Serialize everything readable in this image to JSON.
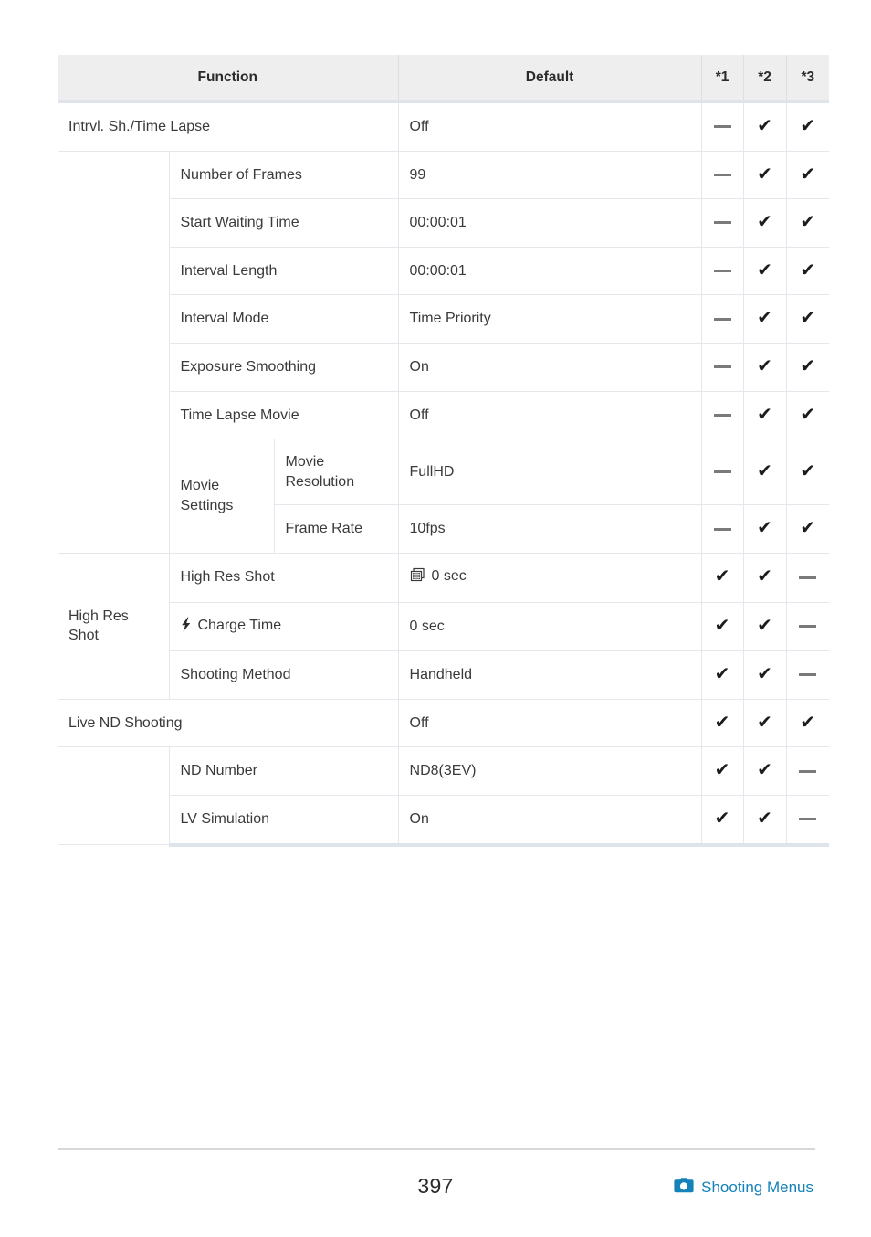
{
  "table": {
    "columns": [
      "Function",
      "Default",
      "*1",
      "*2",
      "*3"
    ],
    "headers": {
      "function": "Function",
      "default": "Default",
      "m1": "*1",
      "m2": "*2",
      "m3": "*3"
    },
    "groups": [
      {
        "group_label": "Intrvl. Sh./Time Lapse",
        "group_is_row": true,
        "row": {
          "name": "Intrvl. Sh./Time Lapse",
          "default": "Off",
          "m1": "dash",
          "m2": "check",
          "m3": "check"
        },
        "rows": [
          {
            "name": "Number of Frames",
            "default": "99",
            "m1": "dash",
            "m2": "check",
            "m3": "check"
          },
          {
            "name": "Start Waiting Time",
            "default": "00:00:01",
            "m1": "dash",
            "m2": "check",
            "m3": "check"
          },
          {
            "name": "Interval Length",
            "default": "00:00:01",
            "m1": "dash",
            "m2": "check",
            "m3": "check"
          },
          {
            "name": "Interval Mode",
            "default": "Time Priority",
            "m1": "dash",
            "m2": "check",
            "m3": "check"
          },
          {
            "name": "Exposure Smoothing",
            "default": "On",
            "m1": "dash",
            "m2": "check",
            "m3": "check"
          },
          {
            "name": "Time Lapse Movie",
            "default": "Off",
            "m1": "dash",
            "m2": "check",
            "m3": "check"
          }
        ],
        "subgroup": {
          "label": "Movie Settings",
          "rows": [
            {
              "name": "Movie Resolution",
              "default": "FullHD",
              "m1": "dash",
              "m2": "check",
              "m3": "check"
            },
            {
              "name": "Frame Rate",
              "default": "10fps",
              "m1": "dash",
              "m2": "check",
              "m3": "check"
            }
          ]
        }
      },
      {
        "group_label": "High Res Shot",
        "group_is_row": false,
        "rows": [
          {
            "name": "High Res Shot",
            "icon": null,
            "default": "0 sec",
            "default_icon": "sensor-shift-icon",
            "m1": "check",
            "m2": "check",
            "m3": "dash"
          },
          {
            "name": "Charge Time",
            "icon": "flash-icon",
            "default": "0 sec",
            "default_icon": null,
            "m1": "check",
            "m2": "check",
            "m3": "dash"
          },
          {
            "name": "Shooting Method",
            "icon": null,
            "default": "Handheld",
            "default_icon": null,
            "m1": "check",
            "m2": "check",
            "m3": "dash"
          }
        ]
      },
      {
        "group_label": "Live ND Shooting",
        "group_is_row": true,
        "row": {
          "name": "Live ND Shooting",
          "default": "Off",
          "m1": "check",
          "m2": "check",
          "m3": "check"
        },
        "rows": [
          {
            "name": "ND Number",
            "default": "ND8(3EV)",
            "m1": "check",
            "m2": "check",
            "m3": "dash"
          },
          {
            "name": "LV Simulation",
            "default": "On",
            "m1": "check",
            "m2": "check",
            "m3": "dash"
          }
        ]
      }
    ]
  },
  "footer": {
    "page_number": "397",
    "section_label": "Shooting Menus",
    "section_icon": "camera-icon",
    "link_color": "#1481b8"
  },
  "symbols": {
    "check": "✔",
    "dash": "—"
  }
}
